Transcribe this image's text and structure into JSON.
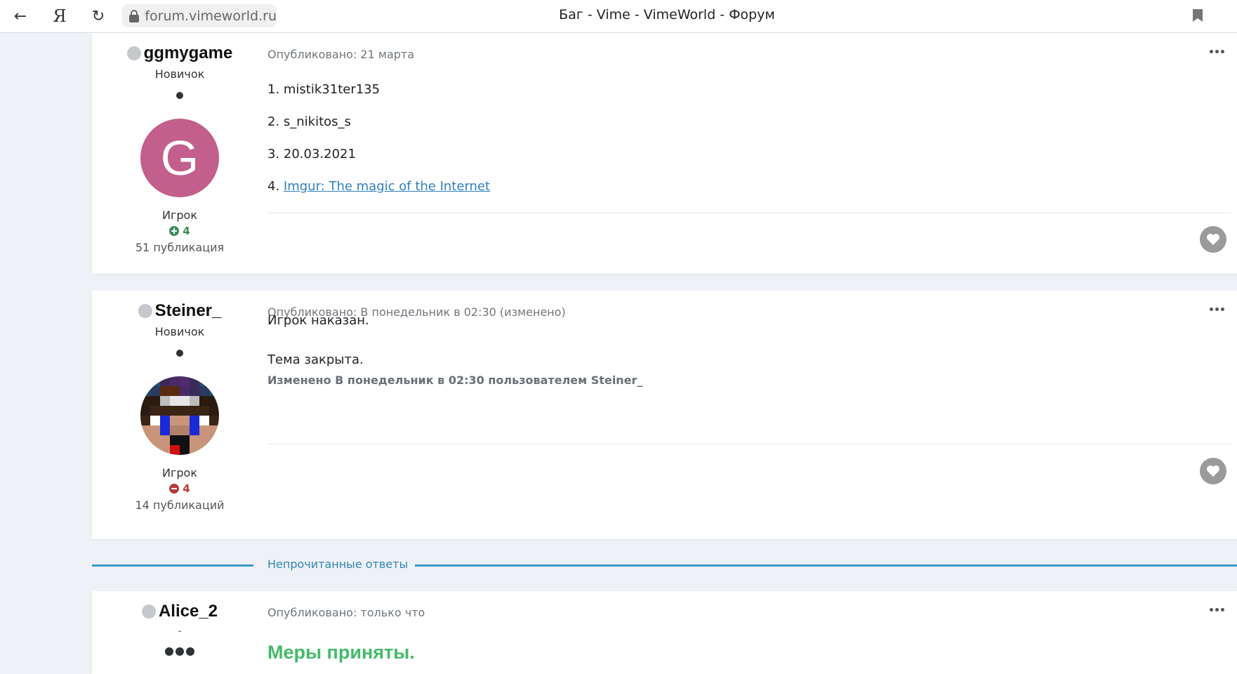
{
  "browser": {
    "url": "forum.vimeworld.ru",
    "page_title": "Баг - Vime - VimeWorld - Форум",
    "back_icon": "←",
    "yandex_icon": "Я",
    "reload_icon": "↻"
  },
  "posts": [
    {
      "author": "ggmygame",
      "title": "Новичок",
      "avatar_letter": "G",
      "avatar_color": "#c25f8c",
      "group": "Игрок",
      "reputation": "4",
      "post_count": "51 публикация",
      "meta": "Опубликовано: 21 марта",
      "lines": [
        "1. mistik31ter135",
        "2. s_nikitos_s",
        "3. 20.03.2021"
      ],
      "link_prefix": "4. ",
      "link_text": "Imgur: The magic of the Internet"
    },
    {
      "author": "Steiner_",
      "title": "Новичок",
      "group": "Игрок",
      "reputation": "4",
      "post_count": "14 публикаций",
      "meta": "Опубликовано: В понедельник в 02:30 (изменено)",
      "lines": [
        "Игрок наказан.",
        "Тема закрыта."
      ],
      "edit_note": "Изменено В понедельник в 02:30 пользователем Steiner_"
    },
    {
      "author": "Alice_2",
      "title": "-",
      "meta": "Опубликовано: только что",
      "message": "Меры приняты."
    }
  ],
  "unread_label": "Непрочитанные ответы",
  "colors": {
    "link": "#2f80c4",
    "rep_positive": "#3c8b57",
    "rep_negative": "#b53a3a",
    "accent_separator": "#3a9ac8",
    "success_text": "#44bb6a"
  }
}
